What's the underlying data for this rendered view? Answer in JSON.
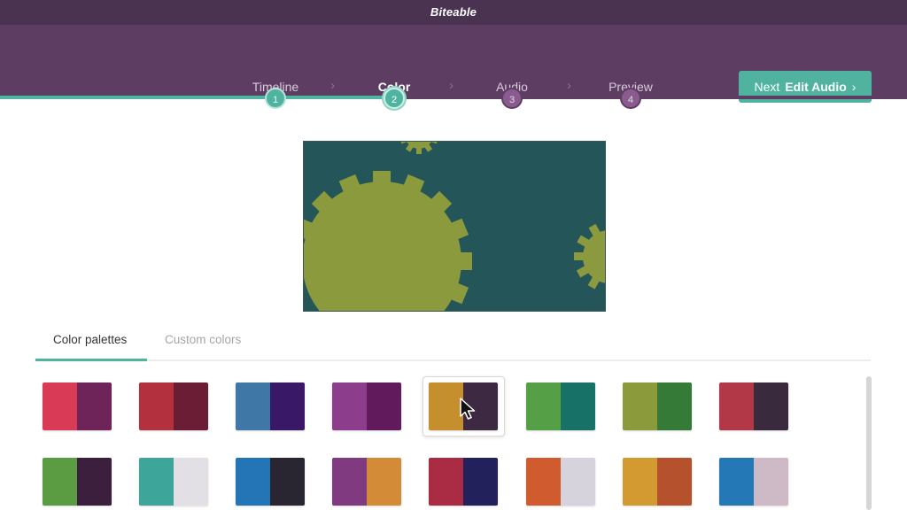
{
  "app": {
    "brand": "Biteable"
  },
  "steps": [
    {
      "label": "Timeline",
      "number": "1",
      "state": "done"
    },
    {
      "label": "Color",
      "number": "2",
      "state": "current"
    },
    {
      "label": "Audio",
      "number": "3",
      "state": "todo"
    },
    {
      "label": "Preview",
      "number": "4",
      "state": "todo"
    }
  ],
  "step_separator": "›",
  "next_button": {
    "prefix": "Next",
    "label": "Edit Audio",
    "chevron": "›"
  },
  "tabs": [
    {
      "label": "Color palettes",
      "active": true
    },
    {
      "label": "Custom colors",
      "active": false
    }
  ],
  "preview": {
    "background": "#245558",
    "gear_color": "#8a9a3c",
    "gear_color_small": "#8b9a3e"
  },
  "colors": {
    "accent": "#4fb3a0",
    "header": "#5e3d63",
    "topbar": "#4a3350"
  },
  "palettes": [
    {
      "left": "#d93a56",
      "right": "#6e2458",
      "selected": false
    },
    {
      "left": "#b3303f",
      "right": "#6b1d36",
      "selected": false
    },
    {
      "left": "#3f78a6",
      "right": "#3a1868",
      "selected": false
    },
    {
      "left": "#8c3d8c",
      "right": "#611a5c",
      "selected": false
    },
    {
      "left": "#c58f2e",
      "right": "#3d2a42",
      "selected": true
    },
    {
      "left": "#55a046",
      "right": "#177166",
      "selected": false
    },
    {
      "left": "#8b9a3a",
      "right": "#357a37",
      "selected": false
    },
    {
      "left": "#b23848",
      "right": "#3a2a3d",
      "selected": false
    },
    {
      "left": "#5b9c43",
      "right": "#3b1f3c",
      "selected": false
    },
    {
      "left": "#3da59a",
      "right": "#e2dfe5",
      "selected": false
    },
    {
      "left": "#2475b5",
      "right": "#292631",
      "selected": false
    },
    {
      "left": "#803a7f",
      "right": "#d48b37",
      "selected": false
    },
    {
      "left": "#aa2b44",
      "right": "#23215c",
      "selected": false
    },
    {
      "left": "#cf5b2e",
      "right": "#d6d3dc",
      "selected": false
    },
    {
      "left": "#d49a32",
      "right": "#b6512d",
      "selected": false
    },
    {
      "left": "#2478b5",
      "right": "#cdbac6",
      "selected": false
    }
  ]
}
